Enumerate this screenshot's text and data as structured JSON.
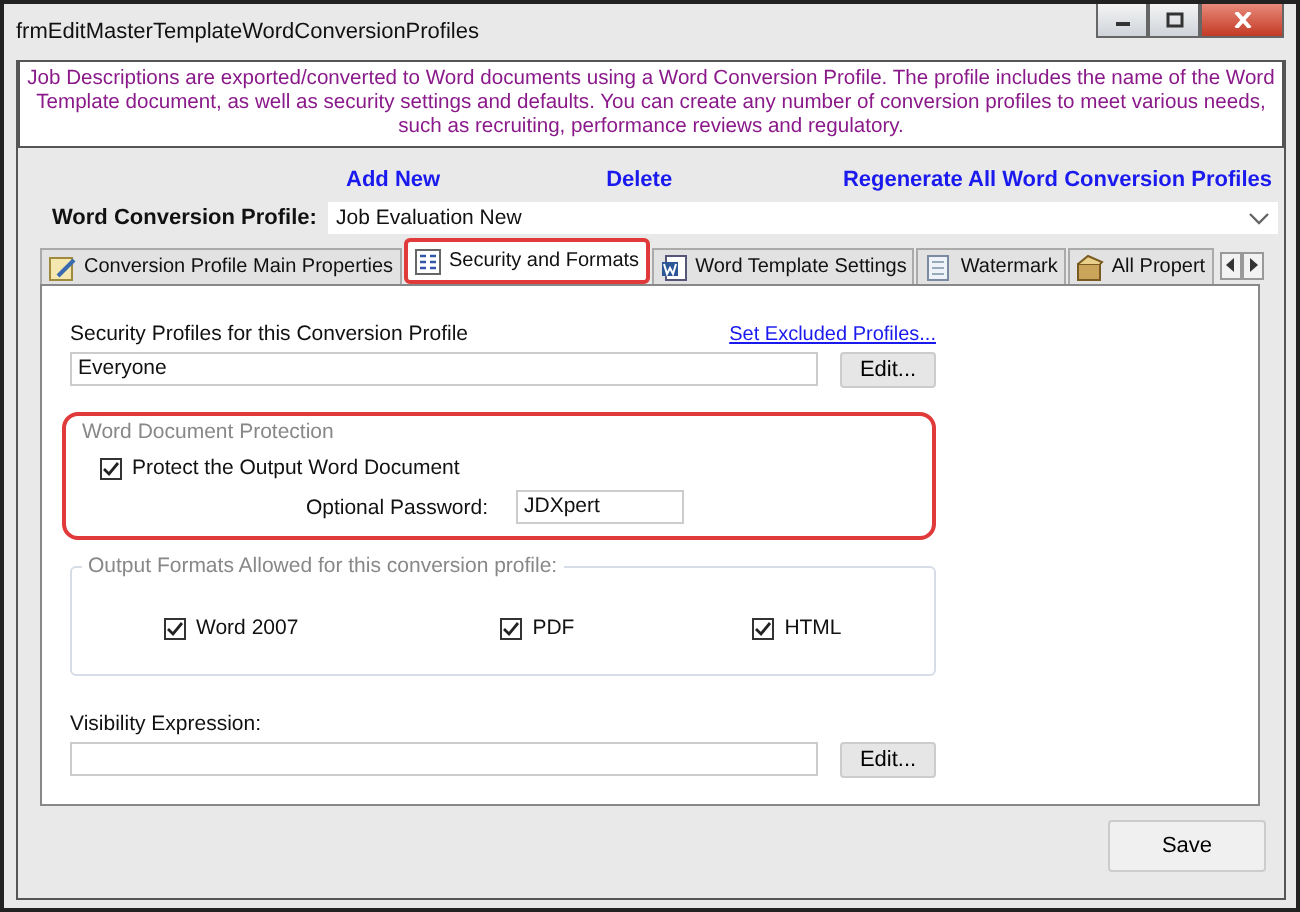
{
  "window": {
    "title": "frmEditMasterTemplateWordConversionProfiles"
  },
  "description": "Job Descriptions are exported/converted to Word documents using a Word Conversion Profile. The profile includes the name of the Word Template document, as well as security settings and defaults.  You can create any number of conversion profiles to meet various needs, such as recruiting, performance reviews and regulatory.",
  "actions": [
    "Add New",
    "Delete",
    "Regenerate All Word Conversion Profiles"
  ],
  "profile": {
    "label": "Word Conversion Profile:",
    "value": "Job Evaluation New"
  },
  "tabs": [
    {
      "label": "Conversion Profile Main Properties",
      "kind": "edit",
      "selected": false
    },
    {
      "label": "Security and Formats",
      "kind": "list",
      "selected": true
    },
    {
      "label": "Word Template Settings",
      "kind": "word",
      "selected": false
    },
    {
      "label": "Watermark",
      "kind": "doc",
      "selected": false
    },
    {
      "label": "All Propert",
      "kind": "box",
      "selected": false
    }
  ],
  "security": {
    "label": "Security Profiles for this Conversion Profile",
    "link": "Set Excluded Profiles...",
    "value": "Everyone",
    "button": "Edit..."
  },
  "protection": {
    "title": "Word Document Protection",
    "highlighted": true,
    "checkbox": {
      "label": "Protect the Output Word Document",
      "checked": true
    },
    "password_label": "Optional Password:",
    "password": "JDXpert"
  },
  "formats": {
    "title": "Output Formats Allowed for this conversion profile:",
    "options": [
      {
        "label": "Word 2007",
        "checked": true
      },
      {
        "label": "PDF",
        "checked": true
      },
      {
        "label": "HTML",
        "checked": true
      }
    ]
  },
  "visibility": {
    "label": "Visibility Expression:",
    "button": "Edit..."
  },
  "save": "Save"
}
